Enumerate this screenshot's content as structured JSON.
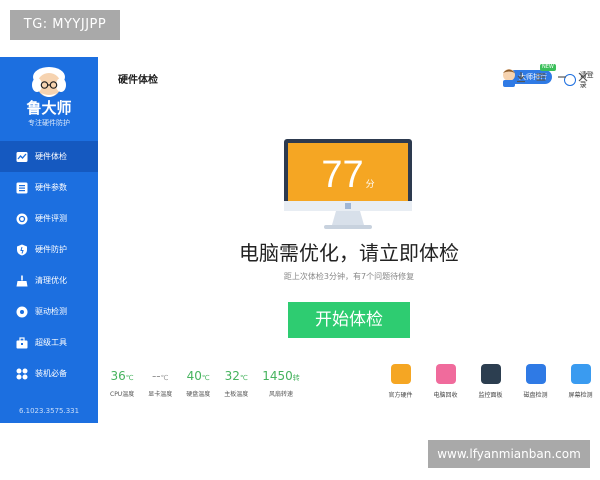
{
  "watermark": {
    "top": "TG: MYYJJPP",
    "bottom": "www.lfyanmianban.com"
  },
  "sidebar": {
    "brand": "鲁大师",
    "brand_sub": "专注硬件防护",
    "items": [
      {
        "label": "硬件体检",
        "icon": "chart-line-icon",
        "active": true
      },
      {
        "label": "硬件参数",
        "icon": "list-icon",
        "active": false
      },
      {
        "label": "硬件评测",
        "icon": "gauge-icon",
        "active": false
      },
      {
        "label": "硬件防护",
        "icon": "shield-icon",
        "active": false
      },
      {
        "label": "清理优化",
        "icon": "broom-icon",
        "active": false
      },
      {
        "label": "驱动检测",
        "icon": "gear-icon",
        "active": false
      },
      {
        "label": "超级工具",
        "icon": "toolbox-icon",
        "active": false
      },
      {
        "label": "装机必备",
        "icon": "apps-icon",
        "active": false
      }
    ],
    "version": "6.1023.3575.331"
  },
  "topbar": {
    "title": "硬件体检",
    "master_button": "大师排行",
    "master_badge": "NEW",
    "login": "请登录"
  },
  "main": {
    "score": "77",
    "score_unit": "分",
    "headline": "电脑需优化，请立即体检",
    "subline": "距上次体检3分钟，有7个问题待修复",
    "start_button": "开始体检"
  },
  "stats": [
    {
      "value": "36",
      "unit": "℃",
      "label": "CPU温度"
    },
    {
      "value": "--",
      "unit": "℃",
      "label": "显卡温度"
    },
    {
      "value": "40",
      "unit": "℃",
      "label": "硬盘温度"
    },
    {
      "value": "32",
      "unit": "℃",
      "label": "主板温度"
    },
    {
      "value": "1450",
      "unit": "转",
      "label": "风扇转速"
    }
  ],
  "tools": [
    {
      "label": "官方硬件",
      "icon": "box-icon",
      "color": "#f5a623"
    },
    {
      "label": "电脑回收",
      "icon": "pig-icon",
      "color": "#f06b9c"
    },
    {
      "label": "监控面板",
      "icon": "monitor-panel-icon",
      "color": "#2c3e50"
    },
    {
      "label": "磁盘检测",
      "icon": "disk-icon",
      "color": "#2f7ae5"
    },
    {
      "label": "屏幕检测",
      "icon": "screen-icon",
      "color": "#3a9bf0"
    }
  ],
  "colors": {
    "sidebar": "#1c6fe0",
    "accent_green": "#2ecc71",
    "screen": "#f5a623"
  }
}
